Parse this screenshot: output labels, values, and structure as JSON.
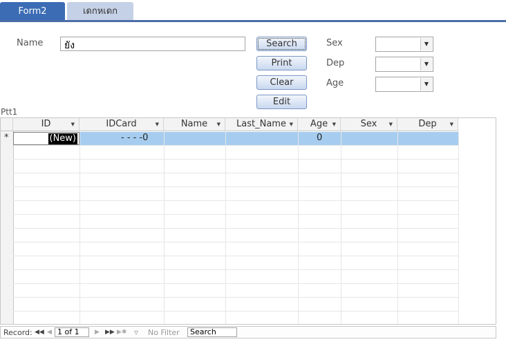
{
  "tabs": [
    {
      "label": "Form2",
      "active": true
    },
    {
      "label": "เดกหเดก",
      "active": false
    }
  ],
  "form": {
    "name_label": "Name",
    "name_value": "ยัง",
    "sex_label": "Sex",
    "dep_label": "Dep",
    "age_label": "Age"
  },
  "buttons": {
    "search": "Search",
    "print": "Print",
    "clear": "Clear",
    "edit": "Edit"
  },
  "subform": {
    "label": "Ptt1",
    "columns": [
      "ID",
      "IDCard",
      "Name",
      "Last_Name",
      "Age",
      "Sex",
      "Dep"
    ],
    "new_row": {
      "marker": "*",
      "id": "(New)",
      "idcard": "- - - -0",
      "age": "0"
    }
  },
  "navigation": {
    "record_label": "Record:",
    "position": "1 of 1",
    "filter_label": "No Filter",
    "search_label": "Search"
  },
  "colors": {
    "tab_active": "#3c6cb4",
    "tab_inactive": "#c5d1e6",
    "new_row_highlight": "#a6cdef"
  }
}
